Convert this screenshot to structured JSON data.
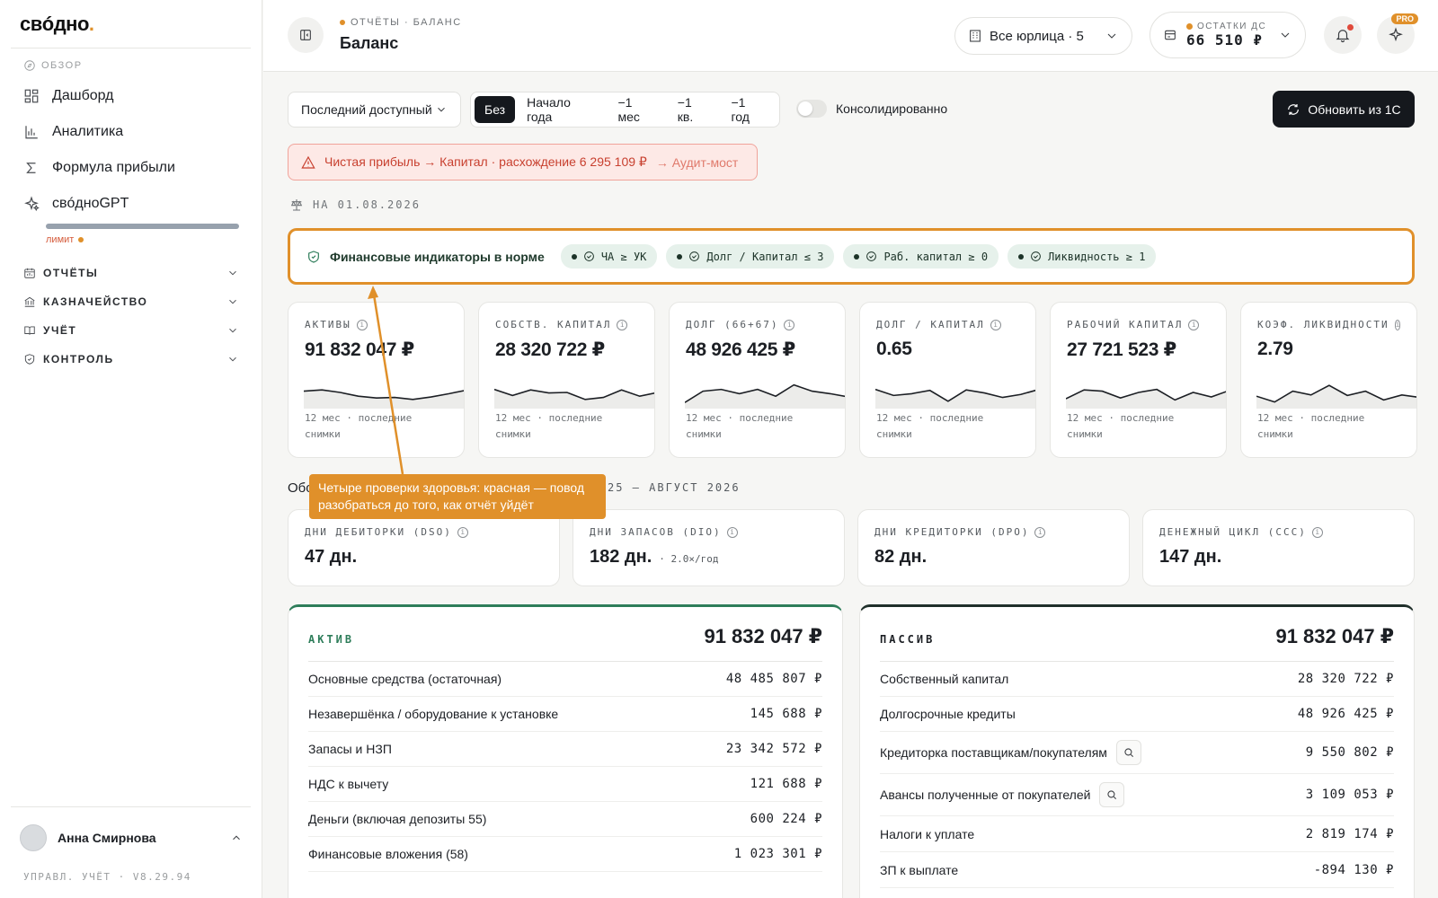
{
  "sidebar": {
    "logo_main": "свóдно",
    "logo_dot": ".",
    "section_label": "ОБЗОР",
    "items": [
      {
        "label": "Дашборд"
      },
      {
        "label": "Аналитика"
      },
      {
        "label": "Формула прибыли"
      },
      {
        "label": "свóдноGPT"
      }
    ],
    "gpt_limit": {
      "label": "лимит",
      "used_fraction": 1.0
    },
    "groups": [
      {
        "label": "ОТЧЁТЫ"
      },
      {
        "label": "КАЗНАЧЕЙСТВО"
      },
      {
        "label": "УЧЁТ"
      },
      {
        "label": "КОНТРОЛЬ"
      }
    ],
    "user_name": "Анна Смирнова",
    "version": "УПРАВЛ. УЧЁТ · V8.29.94"
  },
  "header": {
    "breadcrumb": "ОТЧЁТЫ · БАЛАНС",
    "title": "Баланс",
    "entity_select": "Все юрлица · 5",
    "cash_label": "ОСТАТКИ ДС",
    "cash_value": "66 510 ₽",
    "pro_badge": "PRO"
  },
  "controls": {
    "period": "Последний доступный",
    "compare_options": [
      "Без",
      "Начало года",
      "−1 мес",
      "−1 кв.",
      "−1 год"
    ],
    "compare_active": "Без",
    "consolidated_label": "Консолидированно",
    "consolidated_on": false,
    "refresh_label": "Обновить из 1С"
  },
  "alert": {
    "text": "Чистая прибыль → Капитал · расхождение 6 295 109 ₽",
    "link": "→ Аудит-мост"
  },
  "as_of": "НА 01.08.2026",
  "health": {
    "title": "Финансовые индикаторы в норме",
    "chips": [
      "ЧА ≥ УК",
      "Долг / Капитал ≤ 3",
      "Раб. капитал ≥ 0",
      "Ликвидность ≥ 1"
    ]
  },
  "kpis": [
    {
      "label": "АКТИВЫ",
      "value": "91 832 047 ₽",
      "note": "12 мес · последние снимки",
      "trend": [
        0.55,
        0.6,
        0.5,
        0.35,
        0.28,
        0.3,
        0.22,
        0.32,
        0.45,
        0.6
      ]
    },
    {
      "label": "СОБСТВ. КАПИТАЛ",
      "value": "28 320 722 ₽",
      "note": "12 мес · последние снимки",
      "trend": [
        0.62,
        0.38,
        0.6,
        0.48,
        0.5,
        0.22,
        0.3,
        0.6,
        0.35,
        0.5
      ]
    },
    {
      "label": "ДОЛГ (66+67)",
      "value": "48 926 425 ₽",
      "note": "12 мес · последние снимки",
      "trend": [
        0.1,
        0.55,
        0.62,
        0.45,
        0.62,
        0.35,
        0.8,
        0.55,
        0.45,
        0.32
      ]
    },
    {
      "label": "ДОЛГ / КАПИТАЛ",
      "value": "0.65",
      "note": "12 мес · последние снимки",
      "trend": [
        0.62,
        0.38,
        0.45,
        0.58,
        0.15,
        0.6,
        0.48,
        0.3,
        0.42,
        0.62
      ]
    },
    {
      "label": "РАБОЧИЙ КАПИТАЛ",
      "value": "27 721 523 ₽",
      "note": "12 мес · последние снимки",
      "trend": [
        0.25,
        0.6,
        0.55,
        0.28,
        0.5,
        0.62,
        0.2,
        0.5,
        0.32,
        0.58
      ]
    },
    {
      "label": "КОЭФ. ЛИКВИДНОСТИ",
      "value": "2.79",
      "note": "12 мес · последние снимки",
      "trend": [
        0.35,
        0.12,
        0.55,
        0.4,
        0.78,
        0.38,
        0.55,
        0.2,
        0.4,
        0.3
      ]
    }
  ],
  "turnover": {
    "label": "Обо",
    "range": "25 – АВГУСТ 2026"
  },
  "days": [
    {
      "label": "ДНИ ДЕБИТОРКИ (DSO)",
      "value": "47 дн.",
      "extra": ""
    },
    {
      "label": "ДНИ ЗАПАСОВ (DIO)",
      "value": "182 дн.",
      "extra": "· 2.0×/год"
    },
    {
      "label": "ДНИ КРЕДИТОРКИ (DPO)",
      "value": "82 дн.",
      "extra": ""
    },
    {
      "label": "ДЕНЕЖНЫЙ ЦИКЛ (CCC)",
      "value": "147 дн.",
      "extra": ""
    }
  ],
  "assets": {
    "title": "АКТИВ",
    "total": "91 832 047 ₽",
    "rows": [
      {
        "label": "Основные средства (остаточная)",
        "value": "48 485 807 ₽"
      },
      {
        "label": "Незавершёнка / оборудование к установке",
        "value": "145 688 ₽"
      },
      {
        "label": "Запасы и НЗП",
        "value": "23 342 572 ₽"
      },
      {
        "label": "НДС к вычету",
        "value": "121 688 ₽"
      },
      {
        "label": "Деньги (включая депозиты 55)",
        "value": "600 224 ₽"
      },
      {
        "label": "Финансовые вложения (58)",
        "value": "1 023 301 ₽"
      }
    ]
  },
  "liabilities": {
    "title": "ПАССИВ",
    "total": "91 832 047 ₽",
    "rows": [
      {
        "label": "Собственный капитал",
        "value": "28 320 722 ₽",
        "search": false
      },
      {
        "label": "Долгосрочные кредиты",
        "value": "48 926 425 ₽",
        "search": false
      },
      {
        "label": "Кредиторка поставщикам/покупателям",
        "value": "9 550 802 ₽",
        "search": true
      },
      {
        "label": "Авансы полученные от покупателей",
        "value": "3 109 053 ₽",
        "search": true
      },
      {
        "label": "Налоги к уплате",
        "value": "2 819 174 ₽",
        "search": false
      },
      {
        "label": "ЗП к выплате",
        "value": "-894 130 ₽",
        "search": false
      }
    ]
  },
  "callout": "Четыре проверки здоровья: красная — повод разобраться до того, как отчёт уйдёт",
  "colors": {
    "accent": "#e0902a",
    "positive": "#2e7d5a",
    "alert": "#c8402f",
    "dark": "#15181d"
  }
}
